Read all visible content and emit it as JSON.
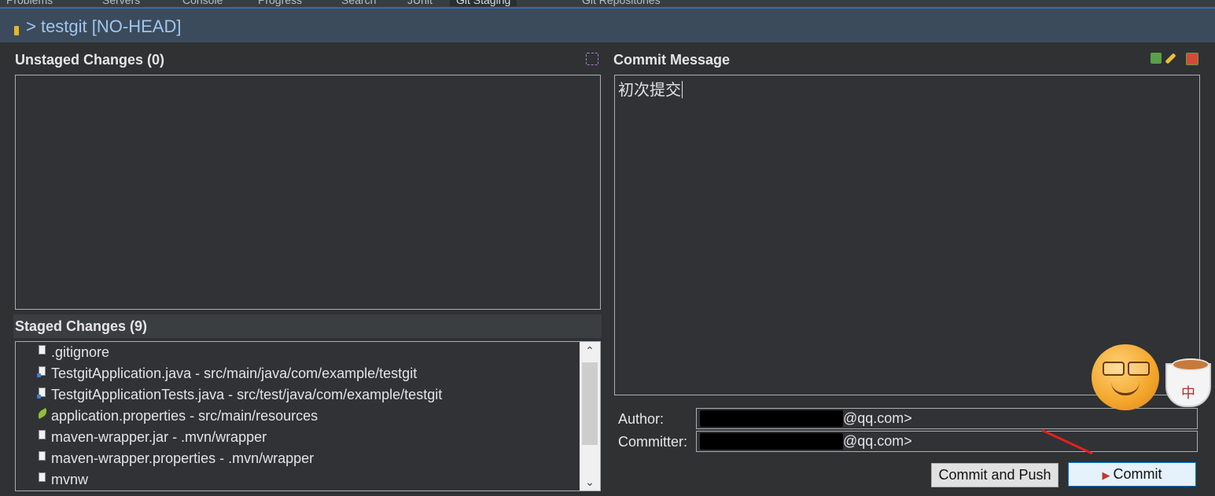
{
  "top_tabs": [
    "Problems",
    "Servers",
    "Console",
    "Progress",
    "Search",
    "JUnit",
    "Git Staging",
    "Git Repositories"
  ],
  "header": {
    "title": "> testgit [NO-HEAD]"
  },
  "unstaged": {
    "title": "Unstaged Changes (0)",
    "files": []
  },
  "staged": {
    "title": "Staged Changes (9)",
    "files": [
      {
        "name": ".gitignore",
        "icon": "file-icon"
      },
      {
        "name": "TestgitApplication.java - src/main/java/com/example/testgit",
        "icon": "java-file-icon"
      },
      {
        "name": "TestgitApplicationTests.java - src/test/java/com/example/testgit",
        "icon": "java-file-icon"
      },
      {
        "name": "application.properties - src/main/resources",
        "icon": "spring-leaf-icon"
      },
      {
        "name": "maven-wrapper.jar - .mvn/wrapper",
        "icon": "file-icon"
      },
      {
        "name": "maven-wrapper.properties - .mvn/wrapper",
        "icon": "file-icon"
      },
      {
        "name": "mvnw",
        "icon": "file-icon"
      }
    ]
  },
  "commit": {
    "title": "Commit Message",
    "message": "初次提交",
    "author_label": "Author:",
    "author_value": "@qq.com>",
    "committer_label": "Committer:",
    "committer_value": "@qq.com>",
    "commit_and_push_label": "Commit and Push",
    "commit_label": "Commit"
  },
  "ime_overlay": {
    "cup_char": "中"
  },
  "colors": {
    "header_bg": "#3c4b5b",
    "header_text": "#9fc6f0",
    "panel_bg": "#303235",
    "annotation_arrow": "#e52020"
  }
}
